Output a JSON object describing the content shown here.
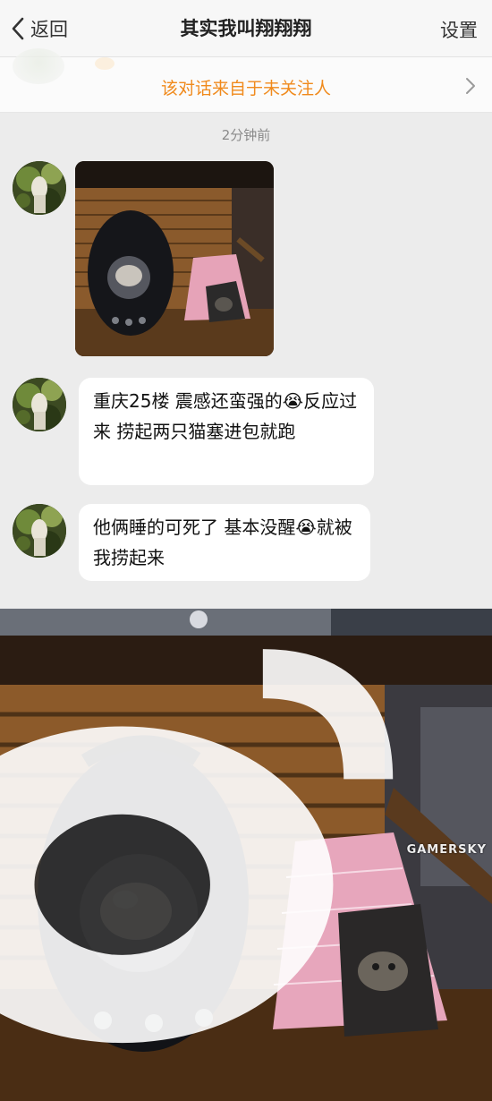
{
  "navbar": {
    "back_label": "返回",
    "title": "其实我叫翔翔翔",
    "settings_label": "设置"
  },
  "notice": {
    "text": "该对话来自于未关注人"
  },
  "chat": {
    "timestamp": "2分钟前",
    "messages": [
      {
        "type": "image"
      },
      {
        "type": "text",
        "text": "重庆25楼 震感还蛮强的😭反应过来 捞起两只猫塞进包就跑"
      },
      {
        "type": "text",
        "text": "他俩睡的可死了 基本没醒😭就被我捞起来"
      }
    ]
  },
  "watermark": {
    "text": "GAMERSKY"
  },
  "colors": {
    "accent_orange": "#f08a1c",
    "chat_background": "#ececec",
    "bubble_background": "#ffffff"
  },
  "icons": {
    "back": "chevron-left-icon",
    "notice_arrow": "chevron-right-icon",
    "watermark_logo": "weibo-icon"
  }
}
